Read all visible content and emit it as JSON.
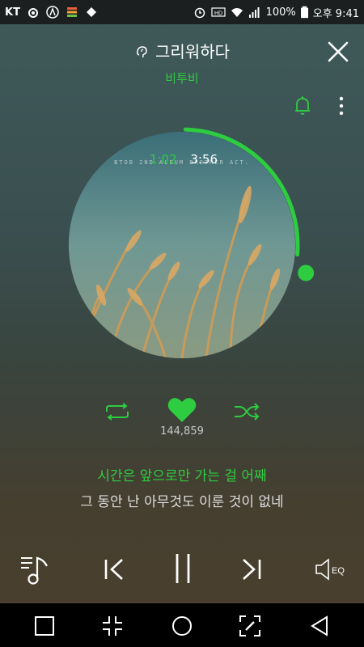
{
  "status_bar": {
    "carrier": "KT",
    "battery": "100%",
    "time": "오후 9:41",
    "icons": [
      "headset-icon",
      "app-icon",
      "notification-icon",
      "tag-icon",
      "alarm-icon",
      "hd-icon",
      "wifi-icon",
      "signal-icon",
      "battery-icon"
    ]
  },
  "header": {
    "song_title": "그리워하다",
    "artist": "비투비"
  },
  "player": {
    "elapsed": "1:02",
    "total": "3:56",
    "progress_fraction": 0.263,
    "album_subtitle": "BTOB 2ND ALBUM   BROTHER ACT."
  },
  "actions": {
    "like_count": "144,859"
  },
  "lyrics": {
    "current": "시간은 앞으로만 가는 걸 어째",
    "next": "그 동안 난 아무것도 이룬 것이 없네"
  },
  "eq_label": "EQ",
  "colors": {
    "accent": "#2ecc40",
    "status_bar": "#1b1f20",
    "nav_bar": "#000000"
  }
}
